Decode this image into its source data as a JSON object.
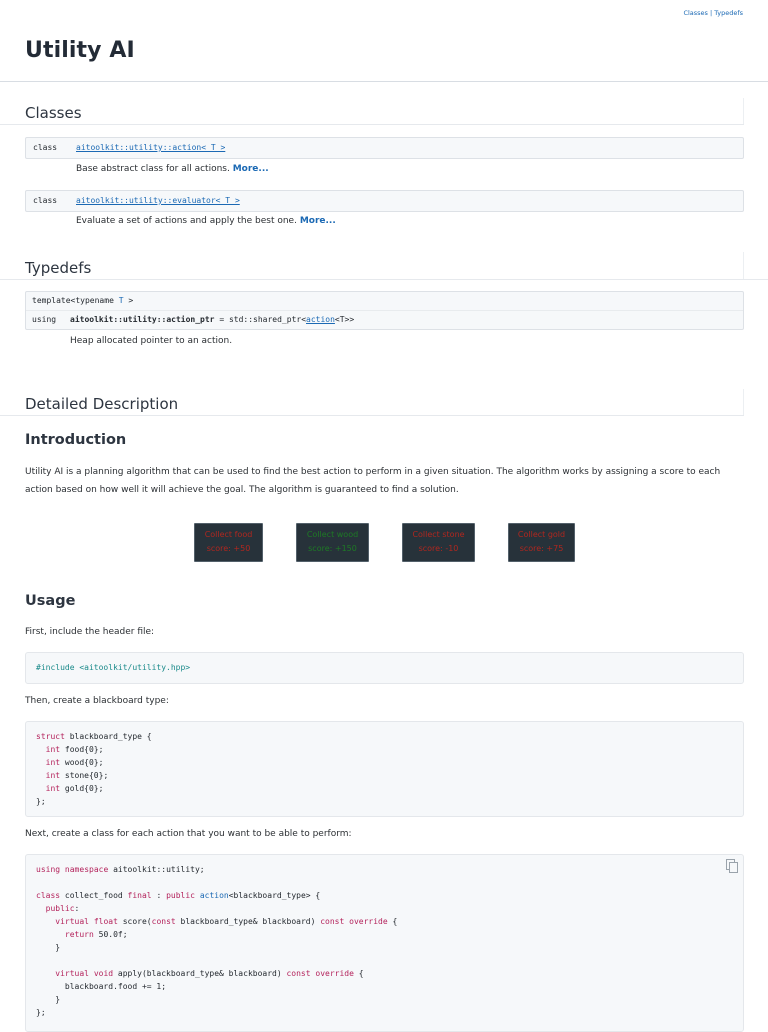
{
  "header": {
    "summary_links": [
      "Classes",
      "Typedefs"
    ],
    "summary_sep": " | ",
    "title": "Utility AI"
  },
  "classes": {
    "heading": "Classes",
    "rows": [
      {
        "kw": "class",
        "name": "aitoolkit::utility::action< T >",
        "desc": "Base abstract class for all actions.",
        "more": "More..."
      },
      {
        "kw": "class",
        "name": "aitoolkit::utility::evaluator< T >",
        "desc": "Evaluate a set of actions and apply the best one.",
        "more": "More..."
      }
    ]
  },
  "typedefs": {
    "heading": "Typedefs",
    "template_kw": "template<typename ",
    "template_t": "T",
    "template_close": " >",
    "using_kw": "using",
    "name_bold": "aitoolkit::utility::action_ptr",
    "name_eq": " = std::shared_ptr<",
    "name_action": "action",
    "name_tail": "<T>>",
    "desc": "Heap allocated pointer to an action."
  },
  "detailed": {
    "heading": "Detailed Description",
    "intro_heading": "Introduction",
    "intro_text": "Utility AI is a planning algorithm that can be used to find the best action to perform in a given situation. The algorithm works by assigning a score to each action based on how well it will achieve the goal. The algorithm is guaranteed to find a solution.",
    "score_boxes": [
      {
        "line1": "Collect food",
        "line2": "score: +50",
        "color": "#b0271f"
      },
      {
        "line1": "Collect wood",
        "line2": "score: +150",
        "color": "#1e7a25"
      },
      {
        "line1": "Collect stone",
        "line2": "score: -10",
        "color": "#b0271f"
      },
      {
        "line1": "Collect gold",
        "line2": "score: +75",
        "color": "#b0271f"
      }
    ],
    "usage_heading": "Usage",
    "step1": "First, include the header file:",
    "include_line": "#include <aitoolkit/utility.hpp>",
    "step2": "Then, create a blackboard type:",
    "step3": "Next, create a class for each action that you want to be able to perform:"
  },
  "colors": {
    "link": "#1b69b4",
    "keyword": "#b4235c",
    "preprocessor": "#1a8a8a"
  },
  "icons": {
    "copy": "copy-icon"
  }
}
